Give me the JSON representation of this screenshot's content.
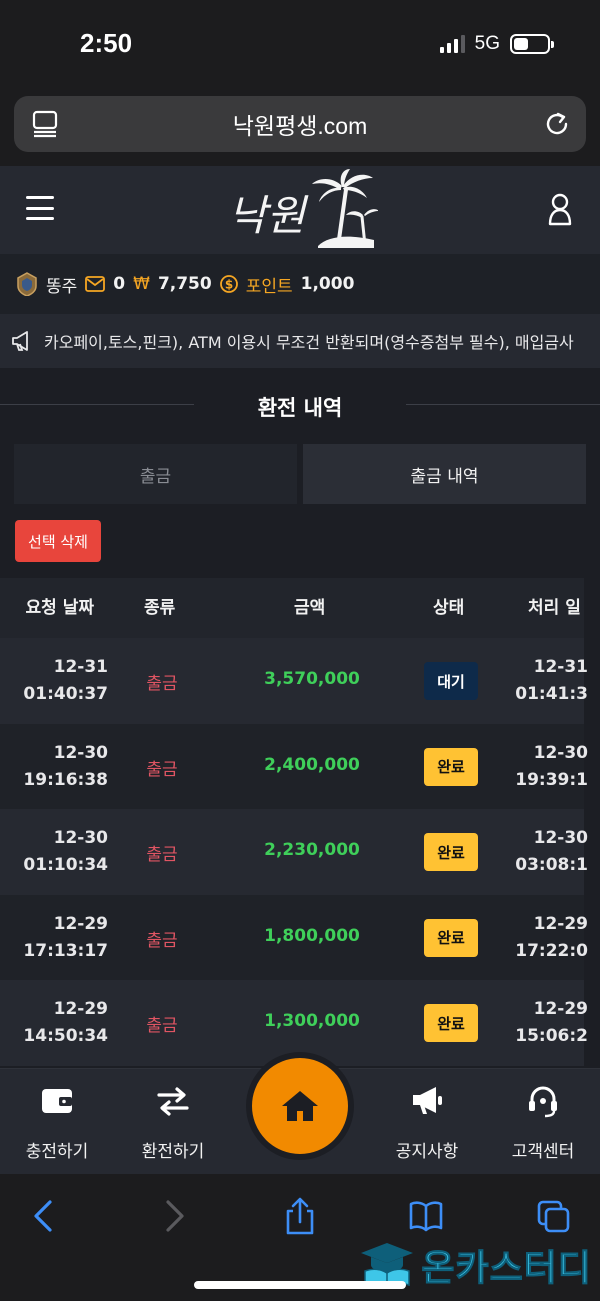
{
  "status": {
    "time": "2:50",
    "network": "5G"
  },
  "browser": {
    "url": "낙원평생.com"
  },
  "site": {
    "logo_text": "낙원"
  },
  "user_bar": {
    "username": "똥주",
    "messages": "0",
    "currency_symbol": "₩",
    "balance": "7,750",
    "point_label": "포인트",
    "points": "1,000"
  },
  "notice": {
    "text": "카오페이,토스,핀크), ATM 이용시 무조건 반환되며(영수증첨부 필수), 매입금사"
  },
  "page": {
    "title": "환전 내역",
    "tabs": [
      {
        "label": "출금",
        "active": false
      },
      {
        "label": "출금 내역",
        "active": true
      }
    ],
    "delete_label": "선택 삭제"
  },
  "table": {
    "headers": {
      "date": "요청 날짜",
      "type": "종류",
      "amount": "금액",
      "status": "상태",
      "processed": "처리 일"
    },
    "rows": [
      {
        "date": "12-31",
        "time": "01:40:37",
        "type": "출금",
        "amount": "3,570,000",
        "status": "대기",
        "status_kind": "wait",
        "proc_date": "12-31",
        "proc_time": "01:41:3"
      },
      {
        "date": "12-30",
        "time": "19:16:38",
        "type": "출금",
        "amount": "2,400,000",
        "status": "완료",
        "status_kind": "done",
        "proc_date": "12-30",
        "proc_time": "19:39:1"
      },
      {
        "date": "12-30",
        "time": "01:10:34",
        "type": "출금",
        "amount": "2,230,000",
        "status": "완료",
        "status_kind": "done",
        "proc_date": "12-30",
        "proc_time": "03:08:1"
      },
      {
        "date": "12-29",
        "time": "17:13:17",
        "type": "출금",
        "amount": "1,800,000",
        "status": "완료",
        "status_kind": "done",
        "proc_date": "12-29",
        "proc_time": "17:22:0"
      },
      {
        "date": "12-29",
        "time": "14:50:34",
        "type": "출금",
        "amount": "1,300,000",
        "status": "완료",
        "status_kind": "done",
        "proc_date": "12-29",
        "proc_time": "15:06:2"
      }
    ]
  },
  "bottom_nav": {
    "charge": "충전하기",
    "exchange": "환전하기",
    "notice": "공지사항",
    "support": "고객센터"
  },
  "watermark": {
    "text": "온카스터디"
  },
  "colors": {
    "accent": "#f28a00",
    "success": "#3fcf5a",
    "danger": "#e05563",
    "badge_done": "#ffc233",
    "badge_wait": "#0e2a4a"
  }
}
